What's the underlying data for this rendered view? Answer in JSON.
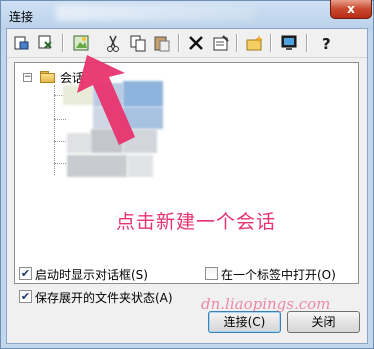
{
  "window": {
    "title": "连接",
    "close_label": "x"
  },
  "toolbar": {
    "buttons": [
      {
        "name": "connect-icon",
        "glyph": "⎆"
      },
      {
        "name": "quick-connect-icon",
        "glyph": "⇆"
      },
      {
        "name": "new-session-icon",
        "glyph": "✦"
      },
      {
        "name": "cut-icon",
        "glyph": "✂"
      },
      {
        "name": "copy-icon",
        "glyph": "⧉"
      },
      {
        "name": "paste-icon",
        "glyph": "📋"
      },
      {
        "name": "delete-icon",
        "glyph": "✕"
      },
      {
        "name": "properties-icon",
        "glyph": "☑"
      },
      {
        "name": "new-folder-icon",
        "glyph": "▭"
      },
      {
        "name": "desktop-shortcut-icon",
        "glyph": "▣"
      },
      {
        "name": "help-icon",
        "glyph": "?"
      }
    ]
  },
  "tree": {
    "root_label": "会话",
    "expander": "−"
  },
  "annotation": {
    "text": "点击新建一个会话",
    "color": "#e8336e"
  },
  "options": {
    "show_on_startup": {
      "label": "启动时显示对话框(S)",
      "checked": true
    },
    "open_in_tab": {
      "label": "在一个标签中打开(O)",
      "checked": false
    },
    "save_expanded": {
      "label": "保存展开的文件夹状态(A)",
      "checked": true
    }
  },
  "buttons": {
    "connect": "连接(C)",
    "close": "关闭"
  },
  "watermark": {
    "text": "dn.liaopings.com"
  }
}
